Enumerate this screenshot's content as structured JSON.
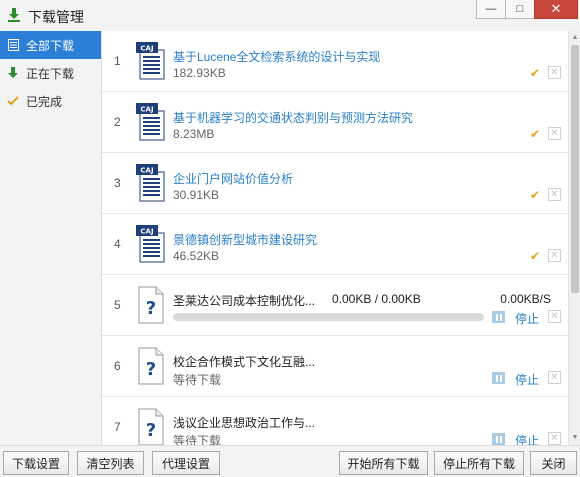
{
  "window": {
    "title": "下载管理",
    "minimize_label": "—",
    "maximize_label": "□",
    "close_label": "✕"
  },
  "sidebar": {
    "items": [
      {
        "label": "全部下载",
        "icon": "list-icon",
        "active": true
      },
      {
        "label": "正在下载",
        "icon": "download-arrow-icon",
        "active": false
      },
      {
        "label": "已完成",
        "icon": "checkmark-icon",
        "active": false
      }
    ]
  },
  "downloads": [
    {
      "num": "1",
      "name": "基于Lucene全文检索系统的设计与实现",
      "size": "182.93KB",
      "status": "completed",
      "icon": "caj-file-icon"
    },
    {
      "num": "2",
      "name": "基于机器学习的交通状态判别与预测方法研究",
      "size": "8.23MB",
      "status": "completed",
      "icon": "caj-file-icon"
    },
    {
      "num": "3",
      "name": "企业门户网站价值分析",
      "size": "30.91KB",
      "status": "completed",
      "icon": "caj-file-icon"
    },
    {
      "num": "4",
      "name": "景德镇创新型城市建设研究",
      "size": "46.52KB",
      "status": "completed",
      "icon": "caj-file-icon"
    },
    {
      "num": "5",
      "name": "圣莱达公司成本控制优化...",
      "ratio": "0.00KB / 0.00KB",
      "speed": "0.00KB/S",
      "progress": 0,
      "status": "downloading",
      "stop_label": "停止",
      "icon": "unknown-file-icon"
    },
    {
      "num": "6",
      "name": "校企合作模式下文化互融...",
      "size": "等待下载",
      "status": "waiting",
      "stop_label": "停止",
      "icon": "unknown-file-icon"
    },
    {
      "num": "7",
      "name": "浅议企业思想政治工作与...",
      "size": "等待下载",
      "status": "waiting",
      "stop_label": "停止",
      "icon": "unknown-file-icon"
    }
  ],
  "footer": {
    "download_settings": "下载设置",
    "clear_list": "清空列表",
    "proxy_settings": "代理设置",
    "start_all": "开始所有下载",
    "stop_all": "停止所有下载",
    "close": "关闭"
  },
  "colors": {
    "accent": "#2b7fd6",
    "link": "#2a7fc9",
    "check": "#e6a21a",
    "close_button": "#c9463d",
    "download_arrow": "#2d8a2d"
  }
}
